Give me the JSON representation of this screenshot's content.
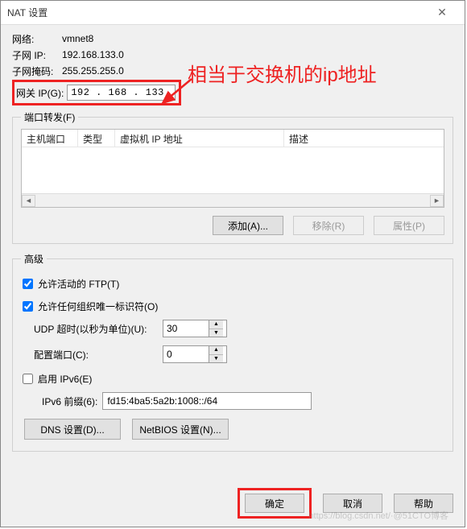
{
  "title": "NAT 设置",
  "network": {
    "label": "网络:",
    "value": "vmnet8"
  },
  "subnet_ip": {
    "label": "子网 IP:",
    "value": "192.168.133.0"
  },
  "subnet_mask": {
    "label": "子网掩码:",
    "value": "255.255.255.0"
  },
  "gateway": {
    "label": "网关 IP(G):",
    "value": "192 . 168 . 133 .   1"
  },
  "annotation": "相当于交换机的ip地址",
  "port_forward": {
    "legend": "端口转发(F)",
    "cols": {
      "host_port": "主机端口",
      "type": "类型",
      "vm_ip": "虚拟机 IP 地址",
      "desc": "描述"
    },
    "add": "添加(A)...",
    "remove": "移除(R)",
    "props": "属性(P)"
  },
  "advanced": {
    "legend": "高级",
    "allow_ftp": "允许活动的 FTP(T)",
    "allow_oui": "允许任何组织唯一标识符(O)",
    "udp_label": "UDP 超时(以秒为单位)(U):",
    "udp_value": "30",
    "cfg_port_label": "配置端口(C):",
    "cfg_port_value": "0",
    "enable_ipv6": "启用 IPv6(E)",
    "ipv6_prefix_label": "IPv6 前缀(6):",
    "ipv6_prefix_value": "fd15:4ba5:5a2b:1008::/64",
    "dns_btn": "DNS 设置(D)...",
    "netbios_btn": "NetBIOS 设置(N)..."
  },
  "footer": {
    "ok": "确定",
    "cancel": "取消",
    "help": "帮助"
  },
  "watermark": "https://blog.csdn.net/·@51CTO博客"
}
